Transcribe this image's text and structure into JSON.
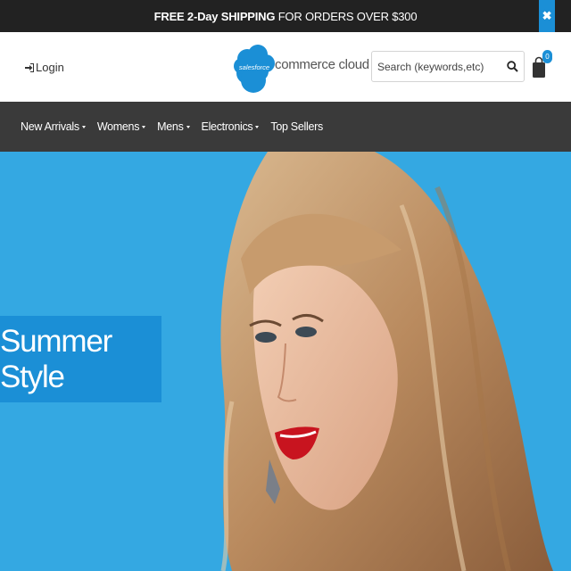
{
  "promo": {
    "bold_text": "FREE 2-Day SHIPPING",
    "rest_text": " FOR ORDERS OVER $300",
    "close_glyph": "✖"
  },
  "header": {
    "login_label": "Login",
    "logo": {
      "cloud_text": "salesforce",
      "brand_rest": "commerce cloud",
      "accent": "#1b8fd6"
    },
    "search": {
      "placeholder": "Search (keywords,etc)",
      "value": ""
    },
    "cart": {
      "count": "0"
    }
  },
  "nav": {
    "items": [
      {
        "label": "New Arrivals",
        "has_dropdown": true
      },
      {
        "label": "Womens",
        "has_dropdown": true
      },
      {
        "label": "Mens",
        "has_dropdown": true
      },
      {
        "label": "Electronics",
        "has_dropdown": true
      },
      {
        "label": "Top Sellers",
        "has_dropdown": false
      }
    ]
  },
  "hero": {
    "headline": "Summer Style",
    "background_color": "#34a8e2",
    "banner_color": "#1b8fd6"
  },
  "colors": {
    "promo_bg": "#222222",
    "nav_bg": "#3a3a3a",
    "accent": "#1b8fd6"
  }
}
